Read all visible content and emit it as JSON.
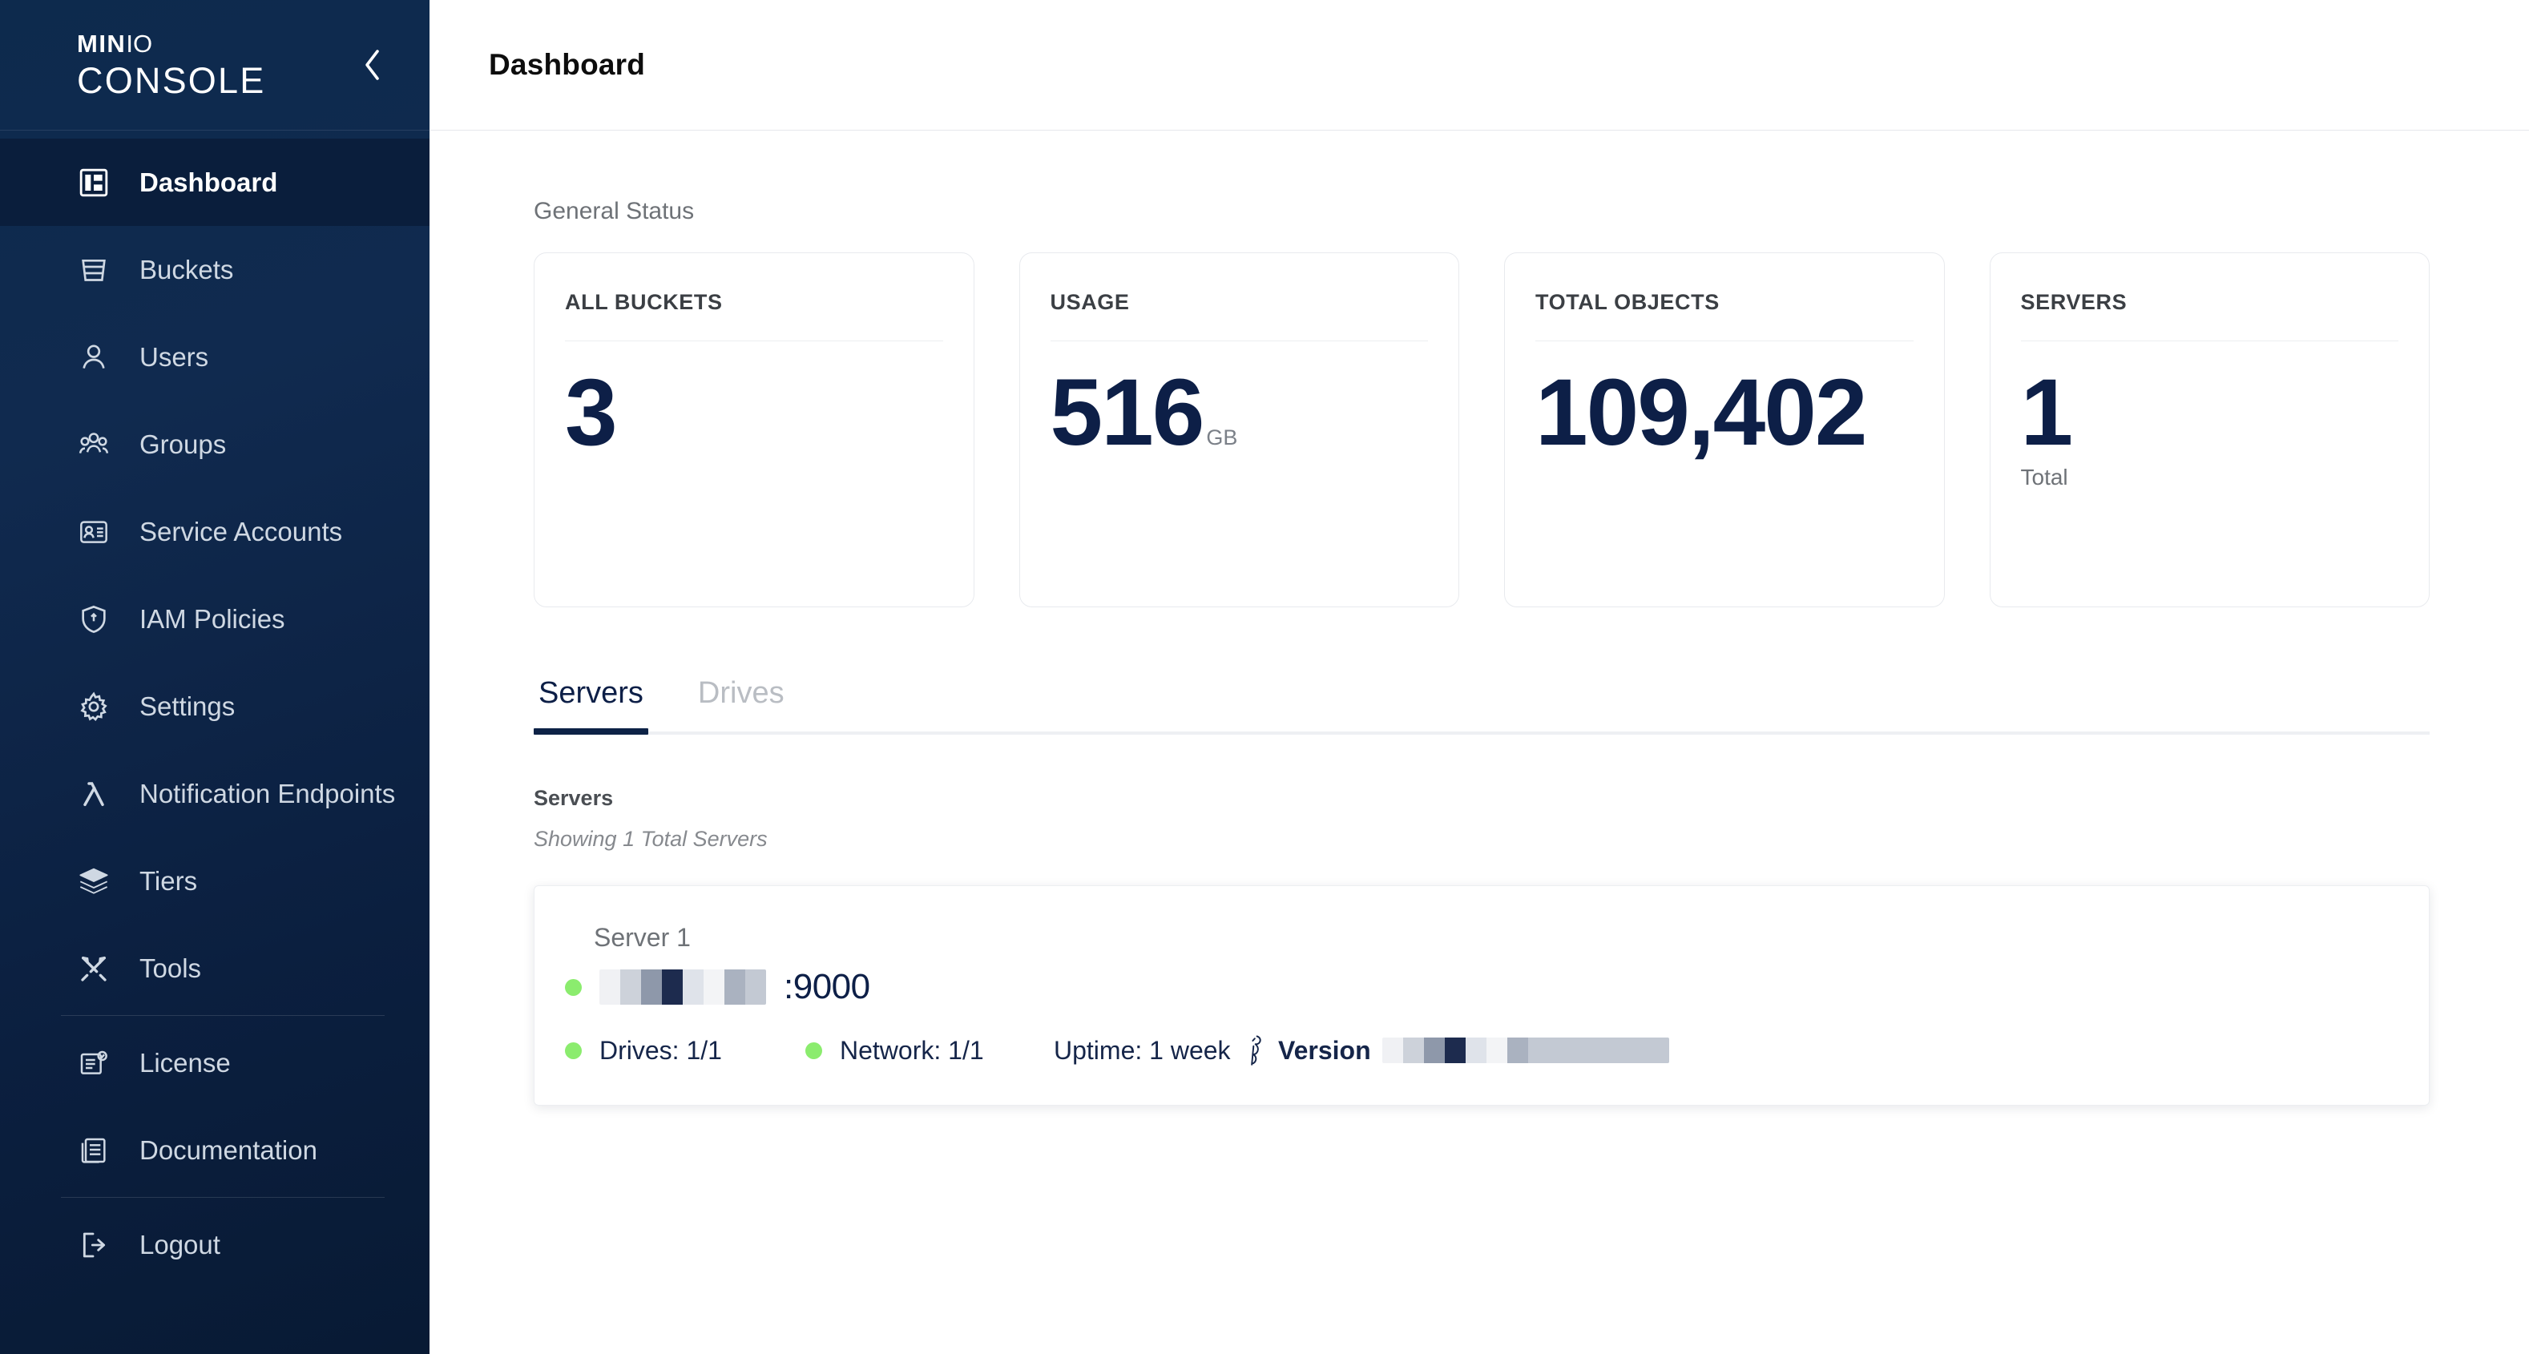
{
  "sidebar": {
    "logo": {
      "brand_top": "MIN",
      "brand_top_io": "IO",
      "brand_bottom": "CONSOLE"
    },
    "collapse_icon": "chevron-left-icon",
    "items": [
      {
        "label": "Dashboard",
        "icon": "dashboard-icon",
        "active": true
      },
      {
        "label": "Buckets",
        "icon": "bucket-icon",
        "active": false
      },
      {
        "label": "Users",
        "icon": "user-icon",
        "active": false
      },
      {
        "label": "Groups",
        "icon": "groups-icon",
        "active": false
      },
      {
        "label": "Service Accounts",
        "icon": "id-card-icon",
        "active": false
      },
      {
        "label": "IAM Policies",
        "icon": "shield-icon",
        "active": false
      },
      {
        "label": "Settings",
        "icon": "gear-icon",
        "active": false
      },
      {
        "label": "Notification Endpoints",
        "icon": "lambda-icon",
        "active": false
      },
      {
        "label": "Tiers",
        "icon": "layers-icon",
        "active": false
      },
      {
        "label": "Tools",
        "icon": "tools-icon",
        "active": false
      },
      {
        "label": "License",
        "icon": "license-document-icon",
        "active": false
      },
      {
        "label": "Documentation",
        "icon": "documentation-icon",
        "active": false
      },
      {
        "label": "Logout",
        "icon": "logout-icon",
        "active": false
      }
    ],
    "dividers_after": [
      9,
      11
    ]
  },
  "header": {
    "title": "Dashboard"
  },
  "main": {
    "section_label": "General Status",
    "cards": [
      {
        "title": "ALL BUCKETS",
        "value": "3",
        "unit": "",
        "sub": ""
      },
      {
        "title": "USAGE",
        "value": "516",
        "unit": "GB",
        "sub": ""
      },
      {
        "title": "TOTAL OBJECTS",
        "value": "109,402",
        "unit": "",
        "sub": ""
      },
      {
        "title": "SERVERS",
        "value": "1",
        "unit": "",
        "sub": "Total"
      }
    ],
    "tabs": [
      {
        "label": "Servers",
        "active": true
      },
      {
        "label": "Drives",
        "active": false
      }
    ],
    "servers_panel": {
      "title": "Servers",
      "subtitle": "Showing 1 Total Servers",
      "server": {
        "name": "Server 1",
        "host_redacted": true,
        "port": ":9000",
        "status_color": "#8bec6e",
        "drives": "Drives: 1/1",
        "network": "Network: 1/1",
        "uptime": "Uptime: 1 week",
        "version_label": "Version",
        "version_redacted": true,
        "version_icon": "minio-bird-icon"
      }
    }
  },
  "colors": {
    "sidebar_top": "#0d2a4d",
    "sidebar_bottom": "#081a34",
    "accent_navy": "#0d1f47",
    "status_green": "#8bec6e",
    "card_border": "#e8eaee"
  }
}
